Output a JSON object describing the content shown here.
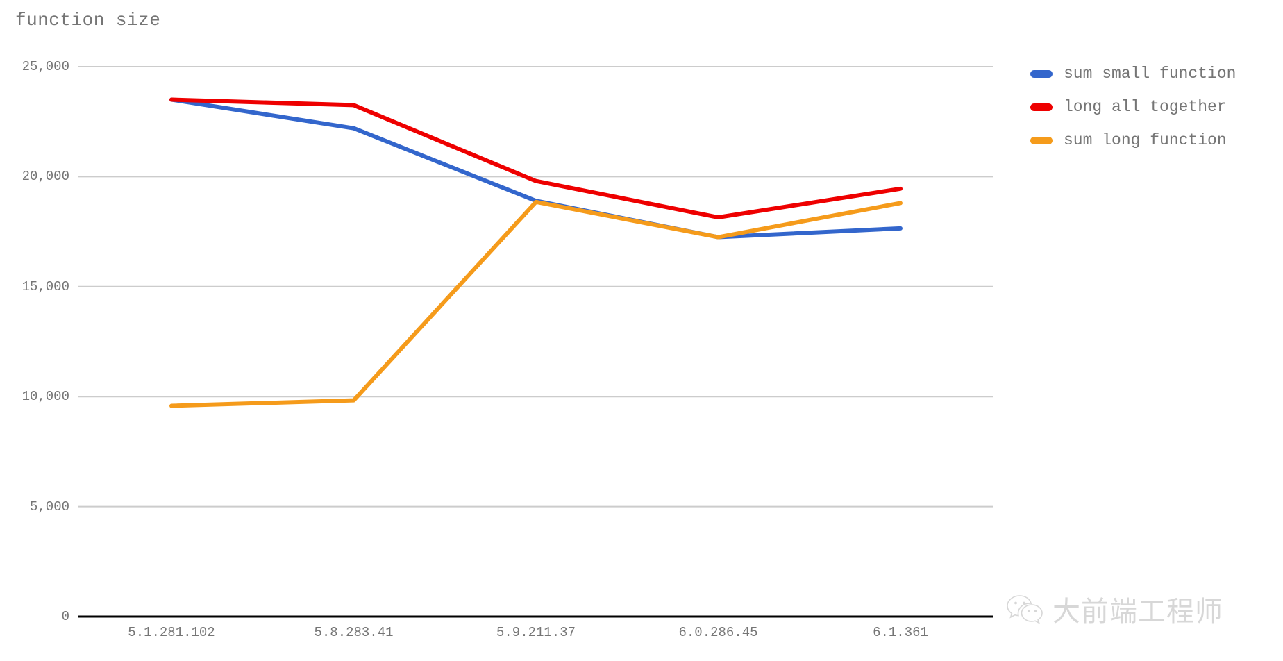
{
  "chart_data": {
    "type": "line",
    "title": "function size",
    "xlabel": "",
    "ylabel": "",
    "categories": [
      "5.1.281.102",
      "5.8.283.41",
      "5.9.211.37",
      "6.0.286.45",
      "6.1.361"
    ],
    "series": [
      {
        "name": "sum small function",
        "color": "#3366CC",
        "values": [
          23500,
          22200,
          18900,
          17250,
          17650
        ]
      },
      {
        "name": "long all together",
        "color": "#EE0000",
        "values": [
          23500,
          23250,
          19800,
          18150,
          19450
        ]
      },
      {
        "name": "sum long function",
        "color": "#F59B1B",
        "values": [
          9580,
          9830,
          18850,
          17250,
          18800
        ]
      }
    ],
    "ylim": [
      0,
      25000
    ],
    "y_ticks": [
      0,
      5000,
      10000,
      15000,
      20000,
      25000
    ],
    "y_tick_labels": [
      "0",
      "5,000",
      "10,000",
      "15,000",
      "20,000",
      "25,000"
    ],
    "grid": true,
    "legend_position": "right",
    "axis_color": "#000000",
    "grid_color": "#cccccc",
    "text_color": "#757575"
  },
  "legend": {
    "items": [
      {
        "label": "sum small function",
        "color": "#3366CC"
      },
      {
        "label": "long all together",
        "color": "#EE0000"
      },
      {
        "label": "sum long function",
        "color": "#F59B1B"
      }
    ]
  },
  "watermark": {
    "icon": "wechat-icon",
    "text": "大前端工程师"
  }
}
